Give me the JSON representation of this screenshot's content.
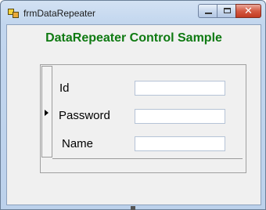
{
  "window": {
    "title": "frmDataRepeater"
  },
  "caption_buttons": {
    "minimize": "minimize",
    "maximize": "maximize",
    "close": "✕"
  },
  "form": {
    "heading": "DataRepeater Control Sample",
    "fields": {
      "id": {
        "label": "Id",
        "value": ""
      },
      "password": {
        "label": "Password",
        "value": ""
      },
      "name": {
        "label": "Name",
        "value": ""
      }
    }
  },
  "colors": {
    "heading": "#0f7a12",
    "close_button": "#c23a22"
  }
}
